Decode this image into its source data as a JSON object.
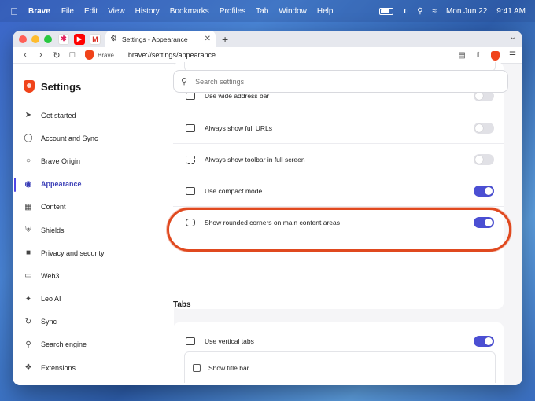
{
  "menubar": {
    "app_name": "Brave",
    "items": [
      "File",
      "Edit",
      "View",
      "History",
      "Bookmarks",
      "Profiles",
      "Tab",
      "Window",
      "Help"
    ],
    "date": "Mon Jun 22",
    "time": "9:41 AM"
  },
  "browser": {
    "tab_title": "Settings - Appearance",
    "new_tab": "+",
    "address_chip": "Brave",
    "url": "brave://settings/appearance"
  },
  "settings": {
    "title": "Settings",
    "search_placeholder": "Search settings",
    "nav": [
      {
        "label": "Get started",
        "icon": "rocket-icon"
      },
      {
        "label": "Account and Sync",
        "icon": "account-icon"
      },
      {
        "label": "Brave Origin",
        "icon": "origin-icon"
      },
      {
        "label": "Appearance",
        "icon": "palette-icon",
        "active": true
      },
      {
        "label": "Content",
        "icon": "content-icon"
      },
      {
        "label": "Shields",
        "icon": "shield-icon"
      },
      {
        "label": "Privacy and security",
        "icon": "lock-icon"
      },
      {
        "label": "Web3",
        "icon": "wallet-icon"
      },
      {
        "label": "Leo AI",
        "icon": "leo-icon"
      },
      {
        "label": "Sync",
        "icon": "sync-icon"
      },
      {
        "label": "Search engine",
        "icon": "search-icon"
      },
      {
        "label": "Extensions",
        "icon": "puzzle-icon"
      }
    ],
    "rows": [
      {
        "label": "Use wide address bar",
        "on": false
      },
      {
        "label": "Always show full URLs",
        "on": false
      },
      {
        "label": "Always show toolbar in full screen",
        "on": false
      },
      {
        "label": "Use compact mode",
        "on": true
      },
      {
        "label": "Show rounded corners on main content areas",
        "on": true
      }
    ],
    "tabs_section": {
      "title": "Tabs",
      "vertical_tabs_label": "Use vertical tabs",
      "vertical_tabs_on": true,
      "title_bar_label": "Show title bar"
    }
  },
  "colors": {
    "accent": "#4b4fd3",
    "highlight": "#e0491f",
    "brave_orange": "#f0431a"
  }
}
